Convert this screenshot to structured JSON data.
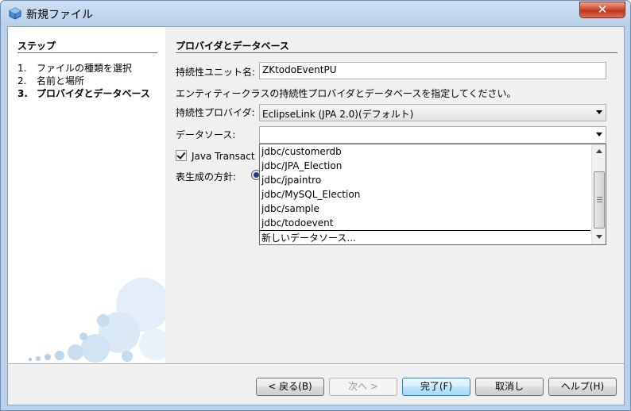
{
  "window": {
    "title": "新規ファイル",
    "close_label": "✕"
  },
  "steps": {
    "title": "ステップ",
    "items": [
      {
        "num": "1.",
        "label": "ファイルの種類を選択"
      },
      {
        "num": "2.",
        "label": "名前と場所"
      },
      {
        "num": "3.",
        "label": "プロバイダとデータベース"
      }
    ]
  },
  "panel": {
    "title": "プロバイダとデータベース",
    "unit_name_label": "持続性ユニット名:",
    "unit_name_value": "ZKtodoEventPU",
    "description": "エンティティークラスの持続性プロバイダとデータベースを指定してください。",
    "provider_label": "持続性プロバイダ:",
    "provider_value": "EclipseLink (JPA 2.0)(デフォルト)",
    "datasource_label": "データソース:",
    "datasource_value": "",
    "java_transaction_label": "Java Transact",
    "table_strategy_label": "表生成の方針:"
  },
  "dropdown": {
    "items": [
      "jdbc/customerdb",
      "jdbc/JPA_Election",
      "jdbc/jpaintro",
      "jdbc/MySQL_Election",
      "jdbc/sample",
      "jdbc/todoevent"
    ],
    "new_datasource": "新しいデータソース..."
  },
  "buttons": {
    "back": "< 戻る(B)",
    "next": "次へ >",
    "finish": "完了(F)",
    "cancel": "取消し",
    "help": "ヘルプ(H)"
  }
}
